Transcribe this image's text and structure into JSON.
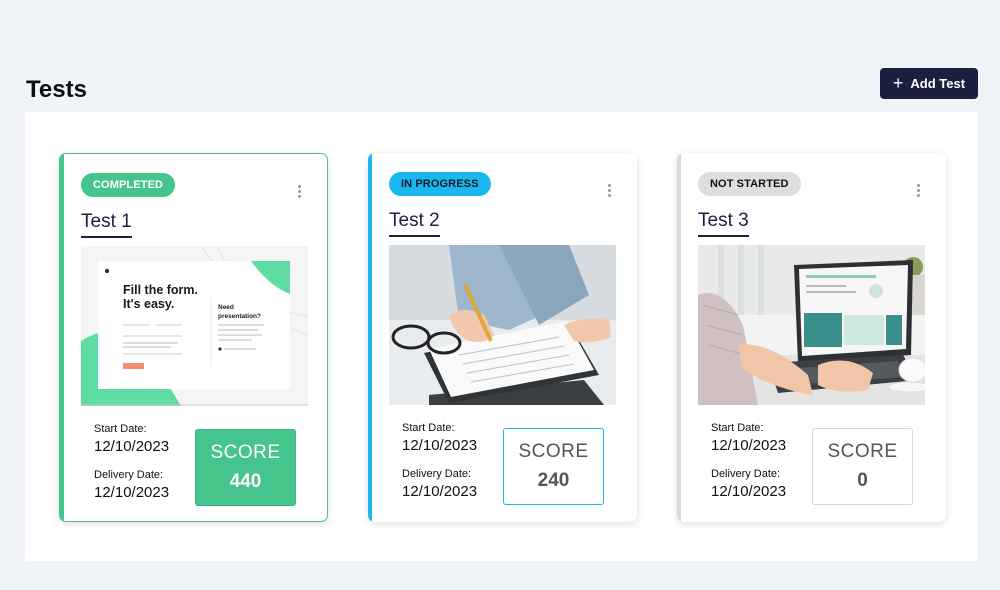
{
  "header": {
    "title": "Tests",
    "add_button_label": "Add Test"
  },
  "tests": [
    {
      "title": "Test 1",
      "status": "COMPLETED",
      "start_label": "Start Date:",
      "start_date": "12/10/2023",
      "delivery_label": "Delivery Date:",
      "delivery_date": "12/10/2023",
      "score_label": "SCORE",
      "score": "440",
      "accent": "#45c48c",
      "thumbnail": {
        "headline_1": "Fill the form.",
        "headline_2": "It's easy.",
        "side_title_1": "Need",
        "side_title_2": "presentation?"
      }
    },
    {
      "title": "Test 2",
      "status": "IN PROGRESS",
      "start_label": "Start Date:",
      "start_date": "12/10/2023",
      "delivery_label": "Delivery Date:",
      "delivery_date": "12/10/2023",
      "score_label": "SCORE",
      "score": "240",
      "accent": "#1ab8ee"
    },
    {
      "title": "Test 3",
      "status": "NOT STARTED",
      "start_label": "Start Date:",
      "start_date": "12/10/2023",
      "delivery_label": "Delivery Date:",
      "delivery_date": "12/10/2023",
      "score_label": "SCORE",
      "score": "0",
      "accent": "#d8d8d8"
    }
  ]
}
